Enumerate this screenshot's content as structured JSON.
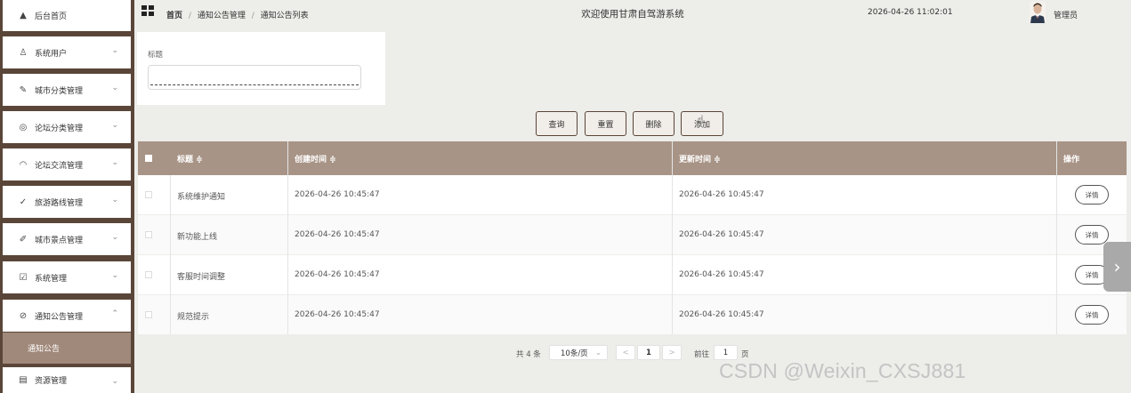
{
  "sidebar": {
    "items": [
      {
        "label": "后台首页",
        "icon": "home-icon",
        "glyph": "⌂"
      },
      {
        "label": "系统用户",
        "icon": "user-icon",
        "glyph": "♙"
      },
      {
        "label": "城市分类管理",
        "icon": "edit-icon",
        "glyph": "✎"
      },
      {
        "label": "论坛分类管理",
        "icon": "category-icon",
        "glyph": "◎"
      },
      {
        "label": "论坛交流管理",
        "icon": "bell-icon",
        "glyph": "⌂"
      },
      {
        "label": "旅游路线管理",
        "icon": "chart-icon",
        "glyph": "✓"
      },
      {
        "label": "城市景点管理",
        "icon": "pen-icon",
        "glyph": "✐"
      },
      {
        "label": "系统管理",
        "icon": "settings-doc-icon",
        "glyph": "☑"
      },
      {
        "label": "通知公告管理",
        "icon": "attachment-icon",
        "glyph": "✎"
      },
      {
        "label": "资源管理",
        "icon": "resource-icon",
        "glyph": "▤"
      }
    ],
    "sub_item": "通知公告",
    "chevron_down": "⌄",
    "chevron_up": "⌃"
  },
  "header": {
    "breadcrumb": [
      "首页",
      "通知公告管理",
      "通知公告列表"
    ],
    "separator": "/",
    "welcome": "欢迎使用甘肃自驾游系统",
    "datetime": "2026-04-26 11:02:01",
    "user": "管理员"
  },
  "search": {
    "label": "标题",
    "value": ""
  },
  "actions": {
    "query": "查询",
    "reset": "重置",
    "delete": "删除",
    "add": "添加"
  },
  "table": {
    "columns": [
      "标题 ≑",
      "创建时间 ≑",
      "更新时间 ≑",
      "操作"
    ],
    "rows": [
      {
        "title": "系统维护通知",
        "created": "2026-04-26 10:45:47",
        "updated": "2026-04-26 10:45:47",
        "action": "详情"
      },
      {
        "title": "新功能上线",
        "created": "2026-04-26 10:45:47",
        "updated": "2026-04-26 10:45:47",
        "action": "详情"
      },
      {
        "title": "客服时间调整",
        "created": "2026-04-26 10:45:47",
        "updated": "2026-04-26 10:45:47",
        "action": "详情"
      },
      {
        "title": "规范提示",
        "created": "2026-04-26 10:45:47",
        "updated": "2026-04-26 10:45:47",
        "action": "详情"
      }
    ]
  },
  "pagination": {
    "total": "共 4 条",
    "page_size": "10条/页",
    "prev": "<",
    "current": "1",
    "next": ">",
    "goto_label": "前往",
    "goto_value": "1",
    "page_unit": "页"
  },
  "watermark": "CSDN @Weixin_CXSJ881",
  "colors": {
    "sidebar_bg": "#5a4638",
    "active_sub": "#a0887a",
    "table_header": "#a89486",
    "main_bg": "#ededea"
  }
}
